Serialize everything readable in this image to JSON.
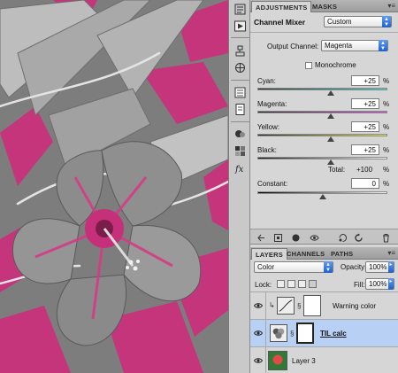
{
  "adjustments_panel": {
    "tabs": [
      "ADJUSTMENTS",
      "MASKS"
    ],
    "active_tab": "ADJUSTMENTS",
    "title": "Channel Mixer",
    "preset": "Custom",
    "output_channel_label": "Output Channel:",
    "output_channel": "Magenta",
    "monochrome_label": "Monochrome",
    "monochrome_checked": false,
    "sliders": [
      {
        "label": "Cyan:",
        "value": "+25",
        "unit": "%",
        "percent": 25,
        "gradient": [
          "#2a2a2a",
          "#3fd6c6"
        ]
      },
      {
        "label": "Magenta:",
        "value": "+25",
        "unit": "%",
        "percent": 25,
        "gradient": [
          "#2a2a2a",
          "#d84cd6"
        ]
      },
      {
        "label": "Yellow:",
        "value": "+25",
        "unit": "%",
        "percent": 25,
        "gradient": [
          "#2a2a2a",
          "#e8e84a"
        ]
      },
      {
        "label": "Black:",
        "value": "+25",
        "unit": "%",
        "percent": 25,
        "gradient": [
          "#111111",
          "#ffffff"
        ]
      }
    ],
    "total_label": "Total:",
    "total_value": "+100",
    "total_unit": "%",
    "constant_label": "Constant:",
    "constant_value": "0",
    "constant_unit": "%",
    "constant_percent": 0
  },
  "layers_panel": {
    "tabs": [
      "LAYERS",
      "CHANNELS",
      "PATHS"
    ],
    "active_tab": "LAYERS",
    "blend_mode": "Color",
    "opacity_label": "Opacity:",
    "opacity": "100%",
    "lock_label": "Lock:",
    "fill_label": "Fill:",
    "fill": "100%",
    "layers": [
      {
        "name": "Warning color",
        "selected": false,
        "kind": "adjustment-curves"
      },
      {
        "name": "TIL calc",
        "selected": true,
        "kind": "adjustment-mixer"
      },
      {
        "name": "Layer 3",
        "selected": false,
        "kind": "pixel"
      }
    ]
  },
  "colors": {
    "accent_blue": "#2f6fe0",
    "selection": "#b7d0f3",
    "photo_magenta": "#d0327e"
  }
}
